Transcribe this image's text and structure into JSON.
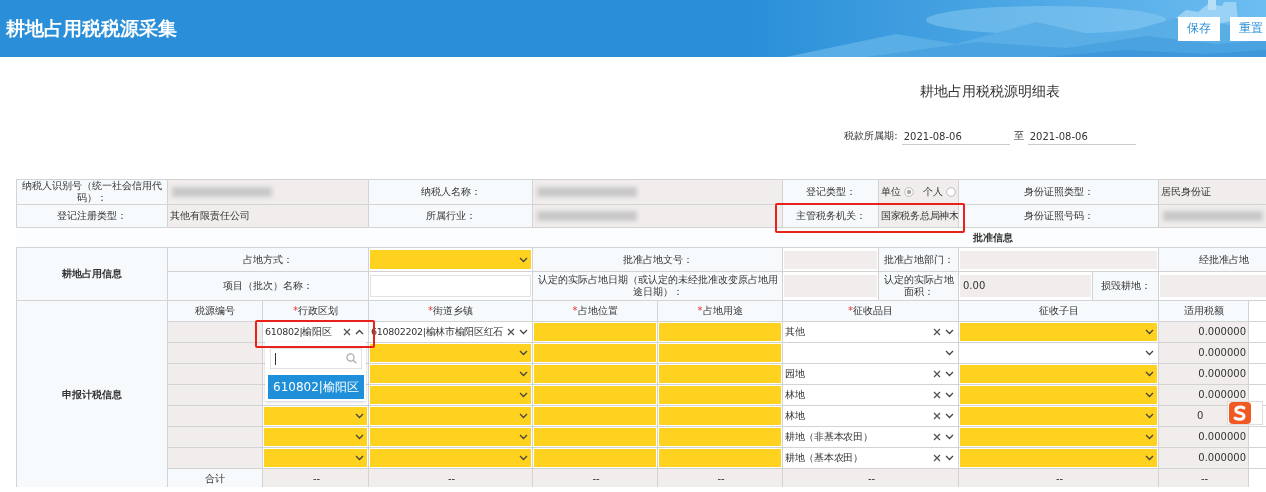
{
  "header": {
    "title": "耕地占用税税源采集",
    "buttons": [
      "保存",
      "重置"
    ]
  },
  "form_title": "耕地占用税税源明细表",
  "period": {
    "label": "税款所属期:",
    "start": "2021-08-06",
    "separator": "至",
    "end": "2021-08-06"
  },
  "taxpayer_rows": [
    [
      {
        "kind": "label",
        "text": "纳税人识别号（统一社会信用代码）："
      },
      {
        "kind": "redacted"
      },
      {
        "kind": "label",
        "text": "纳税人名称："
      },
      {
        "kind": "redacted"
      },
      {
        "kind": "label",
        "text": "登记类型："
      },
      {
        "kind": "radio",
        "options": [
          {
            "label": "单位",
            "selected": true
          },
          {
            "label": "个人",
            "selected": false
          }
        ]
      },
      {
        "kind": "label",
        "text": "身份证照类型："
      },
      {
        "kind": "value",
        "text": "居民身份证"
      }
    ],
    [
      {
        "kind": "label",
        "text": "登记注册类型："
      },
      {
        "kind": "value",
        "text": "其他有限责任公司"
      },
      {
        "kind": "label",
        "text": "所属行业："
      },
      {
        "kind": "redacted"
      },
      {
        "kind": "label",
        "text": "主管税务机关：",
        "highlighted": true
      },
      {
        "kind": "value",
        "text": "国家税务总局神木",
        "highlighted": true
      },
      {
        "kind": "label",
        "text": "身份证照号码："
      },
      {
        "kind": "redacted"
      }
    ]
  ],
  "approval": {
    "section": "耕地占用信息",
    "title": "批准信息",
    "rows": [
      [
        {
          "kind": "label",
          "text": "占地方式："
        },
        {
          "kind": "select",
          "required": true
        },
        {
          "kind": "label",
          "text": "批准占地文号："
        },
        {
          "kind": "input",
          "disabled": true
        },
        {
          "kind": "label",
          "text": "批准占地部门："
        },
        {
          "kind": "input",
          "disabled": true
        },
        {
          "kind": "label",
          "text": "经批准占地"
        }
      ],
      [
        {
          "kind": "label",
          "text": "项目（批次）名称："
        },
        {
          "kind": "input",
          "disabled": false
        },
        {
          "kind": "label",
          "text": "认定的实际占地日期（或认定的未经批准改变原占地用途日期）："
        },
        {
          "kind": "input",
          "disabled": true
        },
        {
          "kind": "label",
          "text": "认定的实际占地面积："
        },
        {
          "kind": "input",
          "value": "0.00",
          "disabled": true
        },
        {
          "kind": "label",
          "text": "损毁耕地："
        },
        {
          "kind": "input",
          "disabled": true
        }
      ]
    ]
  },
  "declaration": {
    "section": "申报计税信息",
    "columns": [
      {
        "label": "税源编号"
      },
      {
        "label": "行政区划",
        "required_mark": "*"
      },
      {
        "label": "街道乡镇",
        "required_mark": "*"
      },
      {
        "label": "占地位置",
        "required_mark": "*"
      },
      {
        "label": "占地用途",
        "required_mark": "*"
      },
      {
        "label": "征收品目",
        "required_mark": "*"
      },
      {
        "label": "征收子目"
      },
      {
        "label": "适用税额"
      }
    ],
    "rows": [
      [
        {
          "kind": "readonly"
        },
        {
          "kind": "select",
          "value": "610802|榆阳区",
          "clearable": true,
          "open": true,
          "highlighted": true,
          "dropdown": {
            "options": [
              {
                "label": "610802|榆阳区",
                "selected": true
              }
            ]
          }
        },
        {
          "kind": "select",
          "value": "610802202|榆林市榆阳区红石",
          "clearable": true
        },
        {
          "kind": "input",
          "required": true
        },
        {
          "kind": "input",
          "required": true
        },
        {
          "kind": "select",
          "value": "其他",
          "clearable": true
        },
        {
          "kind": "select",
          "required": true
        },
        {
          "kind": "number",
          "text": "0.000000"
        }
      ],
      [
        {
          "kind": "readonly"
        },
        {
          "kind": "blank"
        },
        {
          "kind": "select",
          "required": true
        },
        {
          "kind": "input",
          "required": true
        },
        {
          "kind": "input",
          "required": true
        },
        {
          "kind": "select",
          "required": false
        },
        {
          "kind": "select",
          "required": false
        },
        {
          "kind": "number",
          "text": "0.000000"
        }
      ],
      [
        {
          "kind": "readonly"
        },
        {
          "kind": "blank"
        },
        {
          "kind": "select",
          "required": true
        },
        {
          "kind": "input",
          "required": true
        },
        {
          "kind": "input",
          "required": true
        },
        {
          "kind": "select",
          "value": "园地",
          "clearable": true
        },
        {
          "kind": "select",
          "required": true
        },
        {
          "kind": "number",
          "text": "0.000000"
        }
      ],
      [
        {
          "kind": "readonly"
        },
        {
          "kind": "blank"
        },
        {
          "kind": "select",
          "required": true
        },
        {
          "kind": "input",
          "required": true
        },
        {
          "kind": "input",
          "required": true
        },
        {
          "kind": "select",
          "value": "林地",
          "clearable": true
        },
        {
          "kind": "select",
          "required": true
        },
        {
          "kind": "number",
          "text": "0.000000"
        }
      ],
      [
        {
          "kind": "readonly"
        },
        {
          "kind": "select",
          "required": true
        },
        {
          "kind": "select",
          "required": true
        },
        {
          "kind": "input",
          "required": true
        },
        {
          "kind": "input",
          "required": true
        },
        {
          "kind": "select",
          "value": "林地",
          "clearable": true
        },
        {
          "kind": "select",
          "required": true
        },
        {
          "kind": "number",
          "text": "0",
          "partial": true
        }
      ],
      [
        {
          "kind": "readonly"
        },
        {
          "kind": "select",
          "required": true
        },
        {
          "kind": "select",
          "required": true
        },
        {
          "kind": "input",
          "required": true
        },
        {
          "kind": "input",
          "required": true
        },
        {
          "kind": "select",
          "value": "耕地（非基本农田）",
          "clearable": true
        },
        {
          "kind": "select",
          "required": true
        },
        {
          "kind": "number",
          "text": "0.000000"
        }
      ],
      [
        {
          "kind": "readonly"
        },
        {
          "kind": "select",
          "required": true
        },
        {
          "kind": "select",
          "required": true
        },
        {
          "kind": "input",
          "required": true
        },
        {
          "kind": "input",
          "required": true
        },
        {
          "kind": "select",
          "value": "耕地（基本农田）",
          "clearable": true
        },
        {
          "kind": "select",
          "required": true
        },
        {
          "kind": "number",
          "text": "0.000000"
        }
      ]
    ],
    "total": {
      "label": "合计",
      "values": [
        "--",
        "--",
        "--",
        "--",
        "--",
        "--",
        "--"
      ]
    }
  },
  "ime_toolbar": {
    "kind": "floating"
  }
}
